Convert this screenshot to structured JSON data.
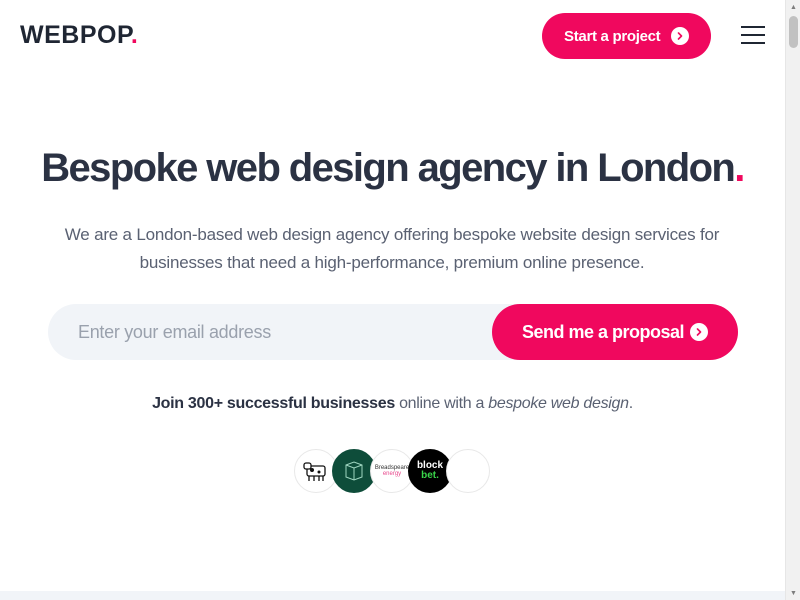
{
  "header": {
    "logo_text": "WEBPOP",
    "logo_dot": ".",
    "cta_label": "Start a project",
    "cta_icon": "chevron-right-circle-icon",
    "menu_icon": "hamburger-menu-icon"
  },
  "hero": {
    "headline": "Bespoke web design agency in London",
    "headline_dot": ".",
    "subhead": "We are a London-based web design agency offering bespoke website design services for businesses that need a high-performance, premium online presence.",
    "email_placeholder": "Enter your email address",
    "email_value": "",
    "send_label": "Send me a proposal",
    "send_icon": "chevron-right-circle-icon"
  },
  "social_proof": {
    "bold": "Join 300+ successful businesses",
    "middle": " online with a ",
    "italic": "bespoke web design",
    "end": "."
  },
  "clients": [
    {
      "name": "cow-logo"
    },
    {
      "name": "green-box-logo"
    },
    {
      "line1": "Breadspeare",
      "line2": "energy"
    },
    {
      "line1": "block",
      "line2": "bet."
    },
    {
      "name": "blank-logo"
    }
  ],
  "colors": {
    "accent": "#f0085e",
    "text": "#2b3243",
    "muted": "#5a6172",
    "input_bg": "#f1f4f8"
  }
}
